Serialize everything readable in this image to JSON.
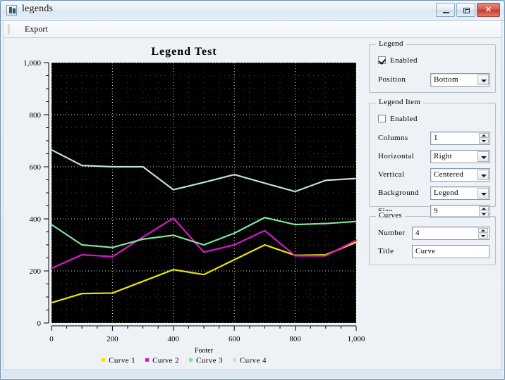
{
  "window": {
    "title": "legends",
    "icon": "app-icon",
    "minimize_label": "–",
    "maximize_label": "□",
    "close_label": "✕"
  },
  "toolbar": {
    "export_label": "Export"
  },
  "panel": {
    "legend_group": {
      "title": "Legend",
      "enabled_label": "Enabled",
      "enabled_checked": true,
      "position_label": "Position",
      "position_value": "Bottom"
    },
    "legend_item_group": {
      "title": "Legend Item",
      "enabled_label": "Enabled",
      "enabled_checked": false,
      "columns_label": "Columns",
      "columns_value": "1",
      "horizontal_label": "Horizontal",
      "horizontal_value": "Right",
      "vertical_label": "Vertical",
      "vertical_value": "Centered",
      "background_label": "Background",
      "background_value": "Legend",
      "size_label": "Size",
      "size_value": "9"
    },
    "curves_group": {
      "title": "Curves",
      "number_label": "Number",
      "number_value": "4",
      "title_label": "Title",
      "title_value": "Curve"
    }
  },
  "chart_data": {
    "type": "line",
    "title": "Legend Test",
    "xlabel": "Footer",
    "ylabel": "",
    "xlim": [
      0,
      1000
    ],
    "ylim": [
      0,
      1000
    ],
    "grid": true,
    "background": "#000000",
    "grid_color": "#ffffff",
    "legend_position": "bottom",
    "xticks": [
      0,
      200,
      400,
      600,
      800,
      1000
    ],
    "xticklabels": [
      "0",
      "200",
      "400",
      "600",
      "800",
      "1,000"
    ],
    "yticks": [
      0,
      200,
      400,
      600,
      800,
      1000
    ],
    "yticklabels": [
      "0",
      "200",
      "400",
      "600",
      "800",
      "1,000"
    ],
    "x": [
      0,
      100,
      200,
      300,
      400,
      500,
      600,
      700,
      800,
      900,
      1000
    ],
    "series": [
      {
        "name": "Curve 1",
        "color": "#e8e800",
        "values": [
          78,
          113,
          115,
          160,
          205,
          186,
          243,
          300,
          260,
          262,
          310
        ]
      },
      {
        "name": "Curve 2",
        "color": "#d617c8",
        "values": [
          210,
          262,
          255,
          330,
          403,
          272,
          300,
          355,
          258,
          258,
          318
        ]
      },
      {
        "name": "Curve 3",
        "color": "#7de89a",
        "values": [
          378,
          300,
          290,
          322,
          337,
          300,
          345,
          405,
          378,
          382,
          390
        ]
      },
      {
        "name": "Curve 4",
        "color": "#bfe0e0",
        "values": [
          665,
          605,
          600,
          600,
          512,
          540,
          570,
          537,
          505,
          548,
          555
        ]
      }
    ]
  }
}
